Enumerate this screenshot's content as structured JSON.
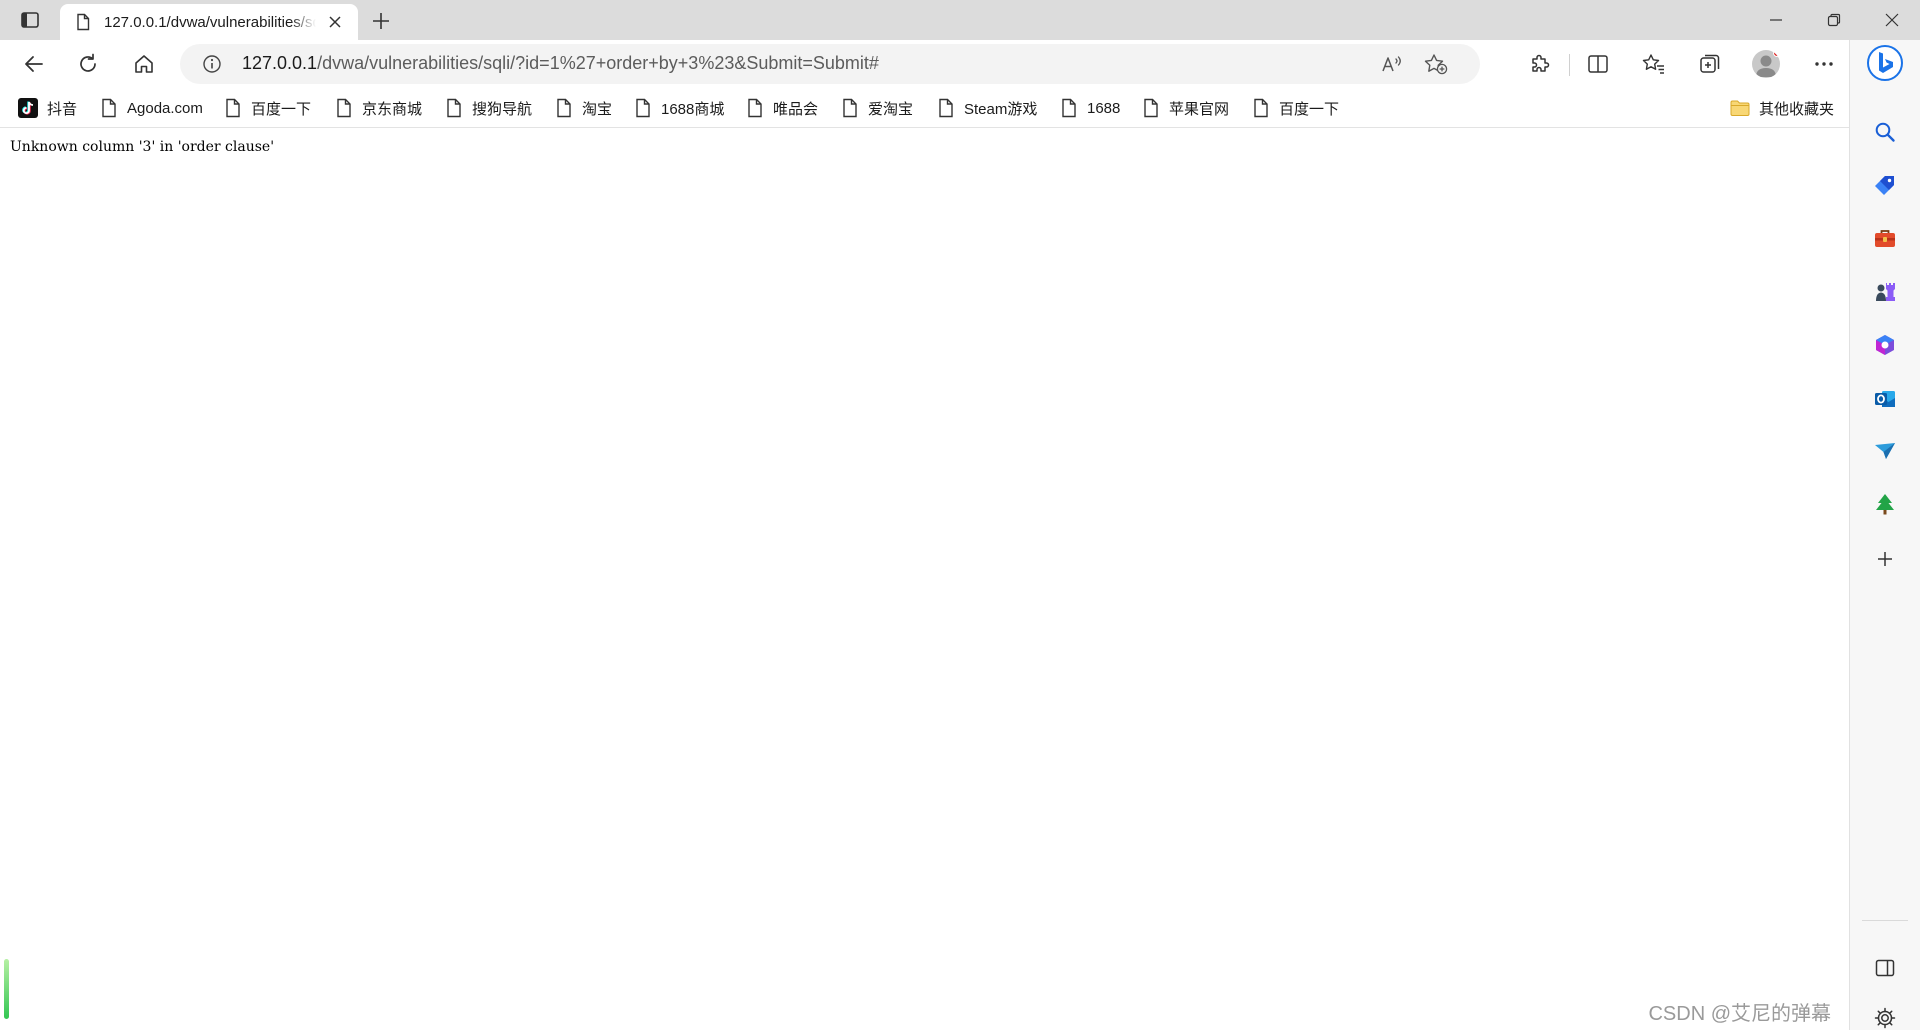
{
  "tab": {
    "title": "127.0.0.1/dvwa/vulnerabilities/sqli/?id=1%27+order+by+3%23&Submit=Submit#"
  },
  "address": {
    "host": "127.0.0.1",
    "path": "/dvwa/vulnerabilities/sqli/?id=1%27+order+by+3%23&Submit=Submit#"
  },
  "favorites": [
    {
      "label": "抖音",
      "icon": "tiktok-icon"
    },
    {
      "label": "Agoda.com",
      "icon": "page-icon"
    },
    {
      "label": "百度一下",
      "icon": "page-icon"
    },
    {
      "label": "京东商城",
      "icon": "page-icon"
    },
    {
      "label": "搜狗导航",
      "icon": "page-icon"
    },
    {
      "label": "淘宝",
      "icon": "page-icon"
    },
    {
      "label": "1688商城",
      "icon": "page-icon"
    },
    {
      "label": "唯品会",
      "icon": "page-icon"
    },
    {
      "label": "爱淘宝",
      "icon": "page-icon"
    },
    {
      "label": "Steam游戏",
      "icon": "page-icon"
    },
    {
      "label": "1688",
      "icon": "page-icon"
    },
    {
      "label": "苹果官网",
      "icon": "page-icon"
    },
    {
      "label": "百度一下",
      "icon": "page-icon"
    }
  ],
  "other_favorites": {
    "label": "其他收藏夹",
    "icon": "folder-icon"
  },
  "content": {
    "error": "Unknown column '3' in 'order clause'"
  },
  "watermark": "CSDN @艾尼的弹幕",
  "colors": {
    "titlebar": "#dcdcdc",
    "address_bg": "#f3f3f3",
    "sidebar_bg": "#f7f7f7",
    "bing_blue": "#1a73e8"
  }
}
